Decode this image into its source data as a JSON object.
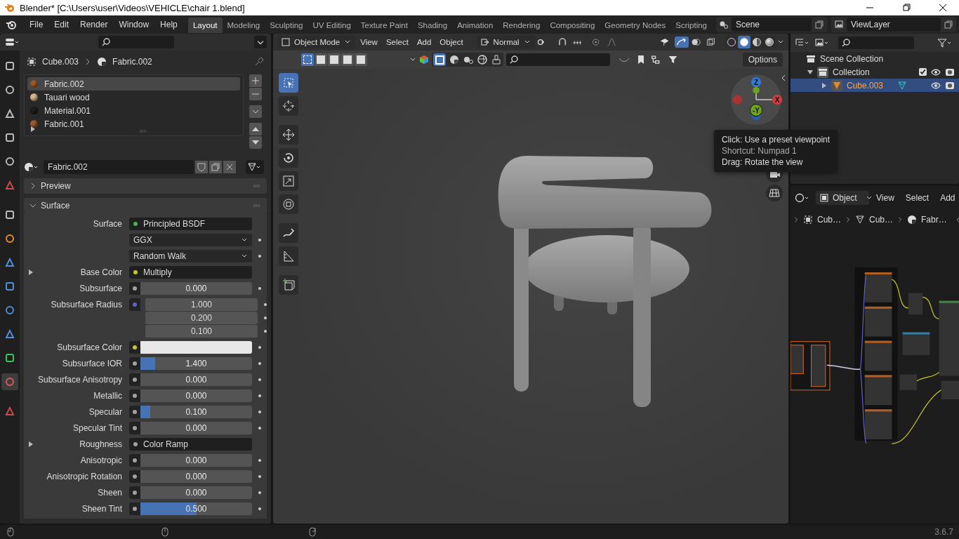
{
  "window": {
    "title": "Blender* [C:\\Users\\user\\Videos\\VEHICLE\\chair 1.blend]"
  },
  "menu": [
    "File",
    "Edit",
    "Render",
    "Window",
    "Help"
  ],
  "workspaces": [
    {
      "label": "Layout",
      "selected": true
    },
    {
      "label": "Modeling",
      "selected": false
    },
    {
      "label": "Sculpting",
      "selected": false
    },
    {
      "label": "UV Editing",
      "selected": false
    },
    {
      "label": "Texture Paint",
      "selected": false
    },
    {
      "label": "Shading",
      "selected": false
    },
    {
      "label": "Animation",
      "selected": false
    },
    {
      "label": "Rendering",
      "selected": false
    },
    {
      "label": "Compositing",
      "selected": false
    },
    {
      "label": "Geometry Nodes",
      "selected": false
    },
    {
      "label": "Scripting",
      "selected": false
    }
  ],
  "scene": "Scene",
  "view_layer": "ViewLayer",
  "properties": {
    "breadcrumb": [
      "Cube.003",
      "Fabric.002"
    ],
    "materials": [
      {
        "name": "Fabric.002",
        "selected": true,
        "color": "#9a5a2a"
      },
      {
        "name": "Tauari wood",
        "selected": false,
        "color": "#d6b68a"
      },
      {
        "name": "Material.001",
        "selected": false,
        "color": "#1e1e1e"
      },
      {
        "name": "Fabric.001",
        "selected": false,
        "color": "#9a5a2a"
      }
    ],
    "material_name": "Fabric.002",
    "panels": [
      {
        "label": "Preview",
        "expanded": false
      },
      {
        "label": "Surface",
        "expanded": true
      }
    ],
    "rows": [
      {
        "kind": "link",
        "label": "Surface",
        "value": "Principled BSDF",
        "color": "#4cb04c"
      },
      {
        "kind": "dropdown",
        "value": "GGX"
      },
      {
        "kind": "dropdown",
        "value": "Random Walk"
      },
      {
        "kind": "link",
        "label": "Base Color",
        "value": "Multiply",
        "color": "#c7c729",
        "expander": true
      },
      {
        "kind": "number",
        "label": "Subsurface",
        "value": "0.000",
        "level": 0,
        "color": "#a1a1a1"
      },
      {
        "kind": "vector",
        "label": "Subsurface Radius",
        "values": [
          "1.000",
          "0.200",
          "0.100"
        ],
        "color": "#6363c7"
      },
      {
        "kind": "swatch",
        "label": "Subsurface Color",
        "color": "#c7c729"
      },
      {
        "kind": "number",
        "label": "Subsurface IOR",
        "value": "1.400",
        "level": 0.13,
        "color": "#a1a1a1"
      },
      {
        "kind": "number",
        "label": "Subsurface Anisotropy",
        "value": "0.000",
        "level": 0,
        "color": "#a1a1a1"
      },
      {
        "kind": "number",
        "label": "Metallic",
        "value": "0.000",
        "level": 0,
        "color": "#a1a1a1"
      },
      {
        "kind": "number",
        "label": "Specular",
        "value": "0.100",
        "level": 0.09,
        "color": "#a1a1a1"
      },
      {
        "kind": "number",
        "label": "Specular Tint",
        "value": "0.000",
        "level": 0,
        "color": "#a1a1a1"
      },
      {
        "kind": "link",
        "label": "Roughness",
        "value": "Color Ramp",
        "color": "#a1a1a1",
        "expander": true
      },
      {
        "kind": "number",
        "label": "Anisotropic",
        "value": "0.000",
        "level": 0,
        "color": "#a1a1a1"
      },
      {
        "kind": "number",
        "label": "Anisotropic Rotation",
        "value": "0.000",
        "level": 0,
        "color": "#a1a1a1"
      },
      {
        "kind": "number",
        "label": "Sheen",
        "value": "0.000",
        "level": 0,
        "color": "#a1a1a1"
      },
      {
        "kind": "number",
        "label": "Sheen Tint",
        "value": "0.500",
        "level": 0.5,
        "color": "#a1a1a1"
      }
    ]
  },
  "viewport": {
    "mode": "Object Mode",
    "menus": [
      "View",
      "Select",
      "Add",
      "Object"
    ],
    "orientation": "Normal",
    "options": "Options",
    "select_modes": [
      {
        "selected": true
      },
      {
        "selected": false
      },
      {
        "selected": false
      },
      {
        "selected": false
      },
      {
        "selected": false
      }
    ],
    "shading": [
      {
        "selected": false
      },
      {
        "selected": true
      },
      {
        "selected": false
      },
      {
        "selected": false
      }
    ],
    "gizmo_axes": [
      {
        "label": "Z",
        "color": "#2f7bd6"
      },
      {
        "label": "X",
        "color": "#d43b3b"
      },
      {
        "label": "-Y",
        "color": "#6aa51c"
      }
    ],
    "tooltip": [
      "Click: Use a preset viewpoint",
      "Shortcut: Numpad 1",
      "Drag: Rotate the view"
    ]
  },
  "outliner": {
    "tree": [
      {
        "label": "Scene Collection",
        "children": [
          {
            "label": "Collection",
            "expanded": true,
            "checked": true,
            "children": [
              {
                "label": "Cube.003",
                "selected": true
              }
            ]
          }
        ]
      }
    ]
  },
  "node_editor": {
    "mode": "Object",
    "menus": [
      "View",
      "Select",
      "Add"
    ],
    "breadcrumb": [
      "Cub…",
      "Cub…",
      "Fabr…"
    ]
  },
  "status": {
    "version": "3.6.7"
  }
}
